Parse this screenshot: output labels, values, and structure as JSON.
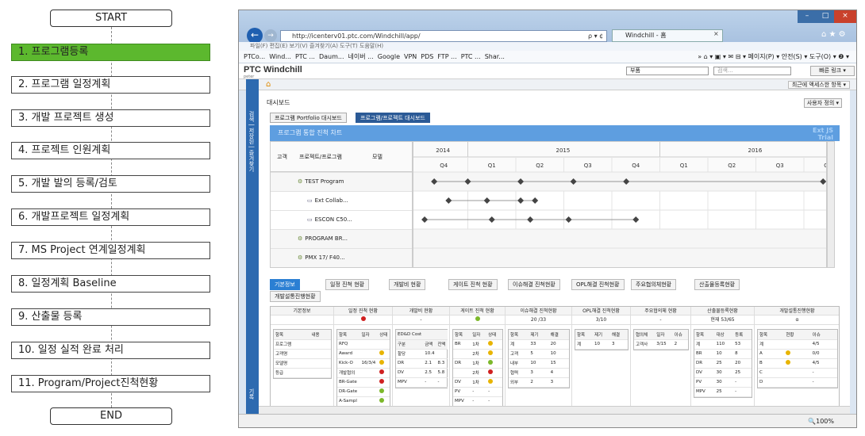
{
  "flow": {
    "start": "START",
    "end": "END",
    "steps": [
      "1. 프로그램등록",
      "2. 프로그램 일정계획",
      "3. 개발 프로젝트 생성",
      "4. 프로젝트 인원계획",
      "5. 개발 발의 등록/검토",
      "6. 개발프로젝트 일정계획",
      "7. MS Project 연계일정계획",
      "8. 일정계획 Baseline",
      "9. 산출물 등록",
      "10. 일정 실적 완료 처리",
      "11. Program/Project진척현황"
    ],
    "active_index": 0,
    "active_color": "#5cb82e"
  },
  "browser": {
    "url": "http://icenterv01.ptc.com/Windchill/app/",
    "url_controls": "ρ ▾ ¢",
    "tab_title": "Windchill - 홈",
    "tab_close": "×",
    "window_buttons": {
      "min": "–",
      "max": "□",
      "close": "×"
    },
    "toolbar_icons": "⌂ ★ ⚙",
    "menu": "파일(F)  편집(E)  보기(V)  즐겨찾기(A)  도구(T)  도움말(H)",
    "favorites": [
      "PTCo...",
      "Wind...",
      "PTC ...",
      "Daum...",
      "네이버 ...",
      "Google",
      "VPN",
      "PDS",
      "FTP ...",
      "PTC ...",
      "Shar..."
    ],
    "fav_right": "» ⌂ ▾  ▣ ▾  ✉ ⊟ ▾  페이지(P) ▾  안전(S) ▾  도구(O) ▾  ❷ ▾",
    "zoom": "🔍100%"
  },
  "app": {
    "logo": "PTC Windchill",
    "user": "peter",
    "scope_select": "부품",
    "search_placeholder": "검색...",
    "quick_link": "빠른 링크 ▾",
    "recent_button": "최근에 액세스한 항목 ▾",
    "sidebar_top": "검색 | 저장된 | 즐겨찾기",
    "sidebar_bottom": "기록",
    "dashboard_title": "대시보드",
    "user_settings": "사용자 정의 ▾",
    "dash_tabs": [
      "프로그램 Portfolio 대시보드",
      "프로그램/프로젝트 대시보드"
    ],
    "active_dash_tab": 1
  },
  "gantt": {
    "title": "프로그램 통합 진척 차트",
    "watermark_1": "Ext JS",
    "watermark_2": "Trial",
    "col_1": "고객",
    "col_2": "프로젝트/프로그램",
    "col_3": "모델",
    "years": [
      "2014",
      "2015",
      "2016"
    ],
    "quarters": [
      "Q4",
      "Q1",
      "Q2",
      "Q3",
      "Q4",
      "Q1",
      "Q2",
      "Q3",
      "Q4"
    ],
    "rows": [
      {
        "label": "TEST Program",
        "type": "program",
        "milestones": [
          0.3,
          1.0,
          2.1,
          3.2,
          4.3,
          8.4
        ]
      },
      {
        "label": "Ext Collab...",
        "type": "project",
        "milestones": [
          0.6,
          1.4,
          2.1,
          2.4
        ]
      },
      {
        "label": "ESCON C50...",
        "type": "project",
        "milestones": [
          0.1,
          1.5,
          2.3,
          3.1,
          4.5
        ]
      },
      {
        "label": "PROGRAM BR...",
        "type": "program",
        "milestones": []
      },
      {
        "label": "PMX 17/ F40...",
        "type": "program",
        "milestones": []
      }
    ]
  },
  "panel_tabs": [
    "기본정보",
    "일정 진척 현황",
    "개발비 현황",
    "게이트 진척 현황",
    "이슈해결 진척현황",
    "OPL해결 진척현황",
    "주요협의체현황",
    "산출물등록현황",
    "개발설통진행현황"
  ],
  "active_panel_tab": 0,
  "summary": [
    {
      "title": "기본정보",
      "sub": ""
    },
    {
      "title": "일정 진척 현황",
      "sub": ""
    },
    {
      "title": "개발비 현황",
      "sub": "-"
    },
    {
      "title": "게이트 진척 현황",
      "sub": ""
    },
    {
      "title": "이슈해결 진척현황",
      "sub": "20 /33"
    },
    {
      "title": "OPL해결 진척현황",
      "sub": "3/10"
    },
    {
      "title": "주요협의체 현황",
      "sub": "-"
    },
    {
      "title": "산출물등록현황",
      "sub": "현재 53/65"
    },
    {
      "title": "개발설통진행현황",
      "sub": "α"
    }
  ],
  "mini_tables": {
    "basic": {
      "header": [
        "항목",
        "내용"
      ],
      "rows": [
        [
          "프로그램",
          ""
        ],
        [
          "고객명",
          ""
        ],
        [
          "모델명",
          ""
        ],
        [
          "등급",
          ""
        ]
      ]
    },
    "schedule": {
      "header": [
        "항목",
        "일자",
        "상태"
      ],
      "rows": [
        [
          "RFQ",
          "",
          ""
        ],
        [
          "Award",
          "",
          "y"
        ],
        [
          "Kick-O",
          "16/3/4",
          "y"
        ],
        [
          "개발협의",
          "",
          "r"
        ],
        [
          "BR-Gate",
          "",
          "r"
        ],
        [
          "DR-Gate",
          "",
          "g"
        ],
        [
          "A-Sampl",
          "",
          "g"
        ],
        [
          "DV-Gate",
          "",
          "g"
        ]
      ]
    },
    "cost": {
      "header": [
        "ED&D Cost",
        "",
        ""
      ],
      "sub": [
        "구분",
        "금액",
        "잔액"
      ],
      "rows": [
        [
          "할당",
          "10.4",
          ""
        ],
        [
          "DR",
          "2.1",
          "8.3"
        ],
        [
          "DV",
          "2.5",
          "5.8"
        ],
        [
          "MPV",
          "-",
          "-"
        ]
      ]
    },
    "gate": {
      "header": [
        "항목",
        "일자",
        "상태"
      ],
      "rows": [
        [
          "BR",
          "1차",
          "y"
        ],
        [
          "",
          "2차",
          "y"
        ],
        [
          "DR",
          "1차",
          "g"
        ],
        [
          "",
          "2차",
          "r"
        ],
        [
          "DV",
          "1차",
          "y"
        ],
        [
          "PV",
          "-",
          "-"
        ],
        [
          "MPV",
          "-",
          "-"
        ]
      ]
    },
    "issue": {
      "header": [
        "항목",
        "제기",
        "해결"
      ],
      "rows": [
        [
          "계",
          "33",
          "20"
        ],
        [
          "고객",
          "5",
          "10"
        ],
        [
          "내부",
          "10",
          "15"
        ],
        [
          "협력",
          "3",
          "4"
        ],
        [
          "외부",
          "2",
          "3"
        ]
      ]
    },
    "opl": {
      "header": [
        "항목",
        "제기",
        "해결"
      ],
      "rows": [
        [
          "계",
          "10",
          "3"
        ]
      ]
    },
    "meeting": {
      "header": [
        "협의체",
        "일자",
        "이슈"
      ],
      "rows": [
        [
          "고객사",
          "3/15",
          "2"
        ]
      ]
    },
    "output": {
      "header": [
        "항목",
        "대상",
        "등록"
      ],
      "rows": [
        [
          "계",
          "110",
          "53"
        ],
        [
          "BR",
          "10",
          "8"
        ],
        [
          "DR",
          "25",
          "20"
        ],
        [
          "DV",
          "30",
          "25"
        ],
        [
          "PV",
          "30",
          "-"
        ],
        [
          "MPV",
          "25",
          "-"
        ]
      ]
    },
    "design": {
      "header": [
        "항목",
        "현황",
        "이슈"
      ],
      "rows": [
        [
          "계",
          "",
          "4/5"
        ],
        [
          "A",
          "y",
          "0/0"
        ],
        [
          "B",
          "y",
          "4/5"
        ],
        [
          "C",
          "",
          "-"
        ],
        [
          "D",
          "",
          "-"
        ]
      ]
    }
  },
  "status_colors": {
    "y": "#e8b400",
    "r": "#d02020",
    "g": "#7cb82a"
  }
}
